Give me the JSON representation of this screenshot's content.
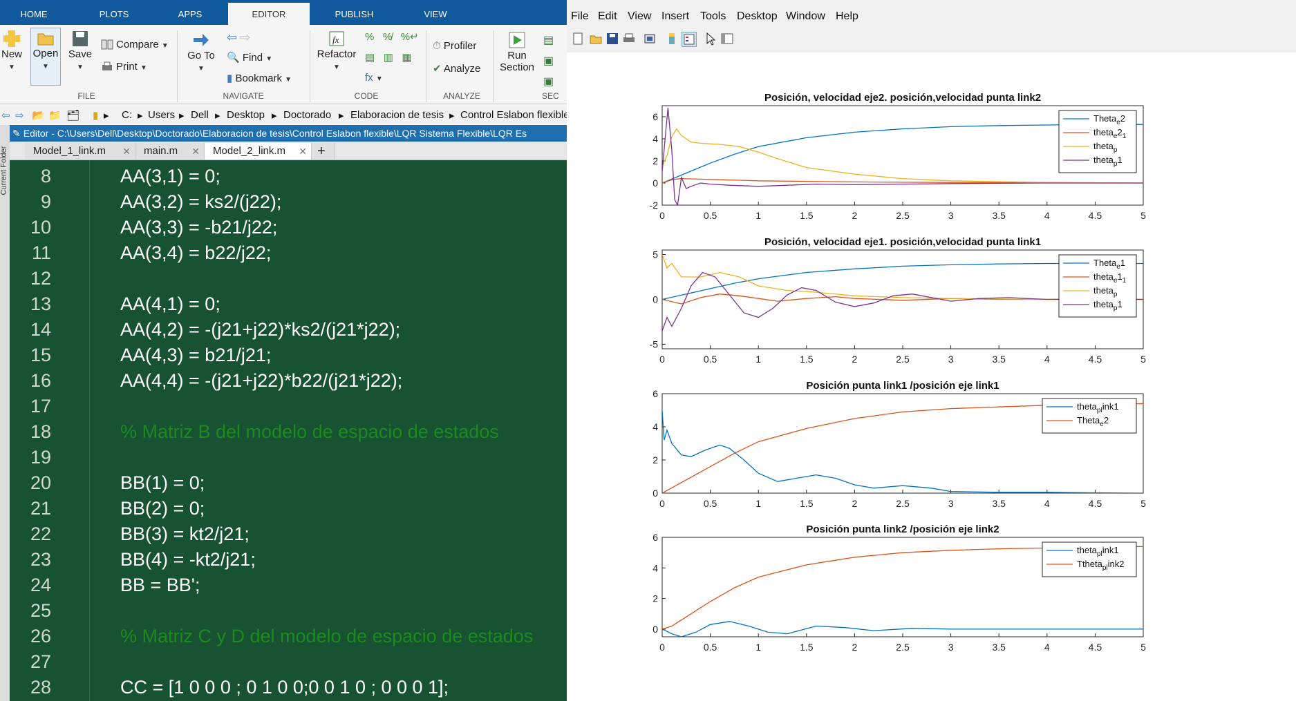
{
  "ribbon_tabs": [
    "HOME",
    "PLOTS",
    "APPS",
    "EDITOR",
    "PUBLISH",
    "VIEW"
  ],
  "ribbon": {
    "new": "New",
    "open": "Open",
    "save": "Save",
    "compare": "Compare",
    "print": "Print",
    "go_to": "Go To",
    "find": "Find",
    "bookmark": "Bookmark",
    "refactor": "Refactor",
    "profiler": "Profiler",
    "analyze": "Analyze",
    "run": "Run",
    "section": "Section",
    "groups": [
      "FILE",
      "NAVIGATE",
      "CODE",
      "ANALYZE",
      "SEC"
    ]
  },
  "address_path": [
    "C:",
    "Users",
    "Dell",
    "Desktop",
    "Doctorado",
    "Elaboracion de tesis",
    "Control Eslabon flexible"
  ],
  "editor_title": "Editor - C:\\Users\\Dell\\Desktop\\Doctorado\\Elaboracion de tesis\\Control Eslabon flexible\\LQR Sistema Flexible\\LQR Es",
  "file_tabs": [
    "Model_1_link.m",
    "main.m",
    "Model_2_link.m"
  ],
  "current_folder_label": "Current Folder",
  "code_lines": [
    {
      "n": "8",
      "text": "AA(3,1) = 0;",
      "comment": false
    },
    {
      "n": "9",
      "text": "AA(3,2) = ks2/(j22);",
      "comment": false
    },
    {
      "n": "10",
      "text": "AA(3,3) = -b21/j22;",
      "comment": false
    },
    {
      "n": "11",
      "text": "AA(3,4) = b22/j22;",
      "comment": false
    },
    {
      "n": "12",
      "text": "",
      "comment": false
    },
    {
      "n": "13",
      "text": "AA(4,1) = 0;",
      "comment": false
    },
    {
      "n": "14",
      "text": "AA(4,2) = -(j21+j22)*ks2/(j21*j22);",
      "comment": false
    },
    {
      "n": "15",
      "text": "AA(4,3) = b21/j21;",
      "comment": false
    },
    {
      "n": "16",
      "text": "AA(4,4) = -(j21+j22)*b22/(j21*j22);",
      "comment": false
    },
    {
      "n": "17",
      "text": "",
      "comment": false
    },
    {
      "n": "18",
      "text": "% Matriz B del modelo de espacio de estados",
      "comment": true
    },
    {
      "n": "19",
      "text": "",
      "comment": false
    },
    {
      "n": "20",
      "text": "BB(1) = 0;",
      "comment": false
    },
    {
      "n": "21",
      "text": "BB(2) = 0;",
      "comment": false
    },
    {
      "n": "22",
      "text": "BB(3) = kt2/j21;",
      "comment": false
    },
    {
      "n": "23",
      "text": "BB(4) = -kt2/j21;",
      "comment": false
    },
    {
      "n": "24",
      "text": "BB = BB';",
      "comment": false
    },
    {
      "n": "25",
      "text": "",
      "comment": false
    },
    {
      "n": "26",
      "text": "% Matriz C y D del modelo de espacio de estados",
      "comment": true
    },
    {
      "n": "27",
      "text": "",
      "comment": false
    },
    {
      "n": "28",
      "text": "CC = [1 0 0 0 ; 0 1 0 0;0 0 1 0 ; 0 0 0 1];",
      "comment": false
    }
  ],
  "figure_menu": [
    "File",
    "Edit",
    "View",
    "Insert",
    "Tools",
    "Desktop",
    "Window",
    "Help"
  ],
  "colors": {
    "blue": "#0072BD",
    "orange": "#D95319",
    "yellow": "#EDB120",
    "purple": "#7E2F8E",
    "editor_bg": "#175233",
    "comment": "#1e8a1e",
    "ribbon_blue": "#0e5a9c"
  },
  "chart_data": [
    {
      "type": "line",
      "title": "Posición, velocidad eje2. posición,velocidad punta link2",
      "xlim": [
        0,
        5
      ],
      "ylim": [
        -2,
        7
      ],
      "xticks": [
        0,
        0.5,
        1,
        1.5,
        2,
        2.5,
        3,
        3.5,
        4,
        4.5,
        5
      ],
      "yticks": [
        -2,
        0,
        2,
        4,
        6
      ],
      "legend": [
        [
          "Theta",
          "e",
          "2"
        ],
        [
          "theta",
          "e",
          "2",
          "1"
        ],
        [
          "theta",
          "p",
          ""
        ],
        [
          "theta",
          "p",
          "1"
        ]
      ],
      "series": [
        {
          "name": "Theta_e2",
          "color": "blue",
          "x": [
            0,
            0.25,
            0.5,
            0.75,
            1,
            1.5,
            2,
            2.5,
            3,
            3.5,
            4,
            4.5,
            5
          ],
          "y": [
            0,
            0.9,
            1.8,
            2.6,
            3.3,
            4.1,
            4.6,
            4.9,
            5.1,
            5.2,
            5.25,
            5.3,
            5.3
          ]
        },
        {
          "name": "theta_e2_1",
          "color": "orange",
          "x": [
            0,
            0.1,
            0.2,
            0.4,
            0.6,
            0.8,
            1,
            1.5,
            2,
            3,
            4,
            5
          ],
          "y": [
            0,
            0.3,
            0.4,
            0.35,
            0.3,
            0.25,
            0.2,
            0.15,
            0.1,
            0.05,
            0.02,
            0
          ]
        },
        {
          "name": "theta_p",
          "color": "yellow",
          "x": [
            0,
            0.05,
            0.1,
            0.15,
            0.2,
            0.3,
            0.4,
            0.6,
            0.8,
            1,
            1.2,
            1.5,
            2,
            2.5,
            3,
            4,
            5
          ],
          "y": [
            1.5,
            2.5,
            4.2,
            4.9,
            4.3,
            3.7,
            3.6,
            3.5,
            3.3,
            2.8,
            2.2,
            1.4,
            0.8,
            0.4,
            0.2,
            0.05,
            0
          ]
        },
        {
          "name": "theta_p1",
          "color": "purple",
          "x": [
            0,
            0.03,
            0.06,
            0.1,
            0.13,
            0.16,
            0.2,
            0.25,
            0.3,
            0.4,
            0.5,
            0.7,
            1,
            1.3,
            1.6,
            2,
            2.5,
            3,
            4,
            5
          ],
          "y": [
            1,
            4,
            6.8,
            3,
            -1.5,
            -2,
            0.5,
            -0.5,
            -0.3,
            0,
            -0.1,
            -0.2,
            -0.3,
            -0.2,
            -0.1,
            -0.15,
            -0.1,
            -0.05,
            0,
            0
          ]
        }
      ]
    },
    {
      "type": "line",
      "title": "Posición, velocidad eje1. posición,velocidad punta link1",
      "xlim": [
        0,
        5
      ],
      "ylim": [
        -5.5,
        5.5
      ],
      "xticks": [
        0,
        0.5,
        1,
        1.5,
        2,
        2.5,
        3,
        3.5,
        4,
        4.5,
        5
      ],
      "yticks": [
        -5,
        0,
        5
      ],
      "legend": [
        [
          "Theta",
          "e",
          "1"
        ],
        [
          "theta",
          "e",
          "1",
          "1"
        ],
        [
          "theta",
          "p",
          ""
        ],
        [
          "theta",
          "p",
          "1"
        ]
      ],
      "series": [
        {
          "name": "Theta_e1",
          "color": "blue",
          "x": [
            0,
            0.25,
            0.5,
            0.75,
            1,
            1.5,
            2,
            2.5,
            3,
            3.5,
            4,
            4.5,
            5
          ],
          "y": [
            0,
            0.6,
            1.2,
            1.8,
            2.3,
            3,
            3.4,
            3.7,
            3.85,
            3.95,
            4,
            4,
            4
          ]
        },
        {
          "name": "theta_e1_1",
          "color": "orange",
          "x": [
            0,
            0.2,
            0.4,
            0.6,
            0.8,
            1,
            1.2,
            1.5,
            1.8,
            2,
            2.5,
            3,
            3.5,
            4,
            5
          ],
          "y": [
            0,
            -0.5,
            0.2,
            0.6,
            0.4,
            0.1,
            -0.2,
            0.1,
            0.3,
            0.1,
            -0.1,
            0.1,
            0,
            0,
            0
          ]
        },
        {
          "name": "theta_p",
          "color": "yellow",
          "x": [
            0,
            0.05,
            0.1,
            0.2,
            0.4,
            0.6,
            0.8,
            1,
            1.3,
            1.6,
            2,
            2.5,
            3,
            4,
            5
          ],
          "y": [
            5,
            3.5,
            4,
            2.5,
            2.5,
            3,
            2.5,
            1.5,
            1,
            0.8,
            0.4,
            0.2,
            0.1,
            0,
            0
          ]
        },
        {
          "name": "theta_p1",
          "color": "purple",
          "x": [
            0,
            0.05,
            0.1,
            0.2,
            0.3,
            0.42,
            0.55,
            0.7,
            0.85,
            1,
            1.15,
            1.3,
            1.45,
            1.6,
            1.8,
            2,
            2.2,
            2.4,
            2.6,
            2.8,
            3,
            3.3,
            3.6,
            4,
            4.5,
            5
          ],
          "y": [
            -3.5,
            -2,
            -3,
            -1,
            1.5,
            3,
            2.5,
            0.5,
            -1.5,
            -2,
            -1,
            0.5,
            1.3,
            1,
            -0.3,
            -0.8,
            -0.4,
            0.4,
            0.6,
            0.2,
            -0.2,
            0.1,
            0.2,
            0,
            0.05,
            0
          ]
        }
      ]
    },
    {
      "type": "line",
      "title": "Posición punta link1 /posición eje link1",
      "xlim": [
        0,
        5
      ],
      "ylim": [
        0,
        6
      ],
      "xticks": [
        0,
        0.5,
        1,
        1.5,
        2,
        2.5,
        3,
        3.5,
        4,
        4.5,
        5
      ],
      "yticks": [
        0,
        2,
        4,
        6
      ],
      "legend": [
        [
          "theta",
          "pl",
          "ink1"
        ],
        [
          "Theta",
          "e",
          "2"
        ]
      ],
      "series": [
        {
          "name": "theta_plink1",
          "color": "blue",
          "x": [
            0,
            0.02,
            0.05,
            0.1,
            0.2,
            0.3,
            0.45,
            0.6,
            0.7,
            0.85,
            1,
            1.2,
            1.4,
            1.6,
            1.8,
            2,
            2.2,
            2.5,
            2.8,
            3,
            3.5,
            4,
            4.5,
            5
          ],
          "y": [
            5,
            3.2,
            3.8,
            3,
            2.3,
            2.2,
            2.6,
            2.9,
            2.7,
            2,
            1.2,
            0.7,
            0.9,
            1.1,
            0.9,
            0.5,
            0.3,
            0.45,
            0.3,
            0.1,
            0.05,
            0.05,
            0.02,
            0
          ]
        },
        {
          "name": "Theta_e2",
          "color": "orange",
          "x": [
            0,
            0.25,
            0.5,
            0.75,
            1,
            1.5,
            2,
            2.5,
            3,
            3.5,
            4,
            4.5,
            5
          ],
          "y": [
            0,
            0.8,
            1.6,
            2.4,
            3.1,
            3.9,
            4.5,
            4.9,
            5.1,
            5.2,
            5.3,
            5.35,
            5.4
          ]
        }
      ]
    },
    {
      "type": "line",
      "title": "Posición punta link2 /posición eje link2",
      "xlim": [
        0,
        5
      ],
      "ylim": [
        -0.5,
        6
      ],
      "xticks": [
        0,
        0.5,
        1,
        1.5,
        2,
        2.5,
        3,
        3.5,
        4,
        4.5,
        5
      ],
      "yticks": [
        0,
        2,
        4,
        6
      ],
      "legend": [
        [
          "theta",
          "pl",
          "ink1"
        ],
        [
          "Ttheta",
          "pl",
          "ink2"
        ]
      ],
      "series": [
        {
          "name": "theta_plink1",
          "color": "blue",
          "x": [
            0,
            0.1,
            0.2,
            0.35,
            0.5,
            0.7,
            0.9,
            1.1,
            1.3,
            1.6,
            1.9,
            2.2,
            2.6,
            3,
            3.5,
            4,
            5
          ],
          "y": [
            0,
            -0.3,
            -0.5,
            -0.2,
            0.3,
            0.5,
            0.2,
            -0.2,
            -0.3,
            0.2,
            0.1,
            -0.1,
            0.05,
            0,
            0,
            0,
            0
          ]
        },
        {
          "name": "Ttheta_plink2",
          "color": "orange",
          "x": [
            0,
            0.1,
            0.25,
            0.5,
            0.75,
            1,
            1.5,
            2,
            2.5,
            3,
            3.5,
            4,
            4.5,
            5
          ],
          "y": [
            0,
            0.2,
            0.8,
            1.8,
            2.7,
            3.4,
            4.2,
            4.7,
            5,
            5.15,
            5.25,
            5.3,
            5.35,
            5.4
          ]
        }
      ]
    }
  ]
}
